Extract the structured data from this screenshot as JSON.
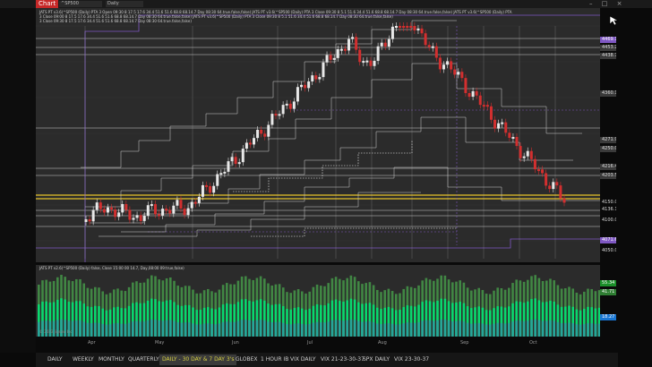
{
  "window": {
    "chart_tab": "Chart",
    "symbol": "^SP500",
    "timeframe": "Daily",
    "controls": "– □ ×"
  },
  "price_panel": {
    "header_lines": [
      "JATS PT v3.6(^SP500 (Daily) PTA 3 Open 09:30 8 17.5 17.6 34.4 51.6 51.6 68.8 68.14.7 Day 08:30 64.true.false,false) JATS PT v3.6(^SP500 (Daily) PTA 3 Close 09:30 8 5.1 51.6 34.4 51.6 68.8 68.14.7 Day 08:30 64.true.false,false) JATS PT v3.6(^SP500 (Daily) PTA",
      "3 Close 09:00 8 17.5 17.6 34.4 51.6 51.6 68.8 68.14.7 Day 08:30 64.true.false,false) JATS PT v3.6(^SP500 (Daily) PTA 3 Close 09:30 8 5.1 51.6 34.4 51.6 68.8 68.14.7 Day 08:30 64.true.false,false)",
      "3 Close 09:30 8 17.5 17.6 34.4 51.6 51.6 68.8 68.14.7 Day 08:30 64.true.false,false)"
    ],
    "axis_ticks": [
      "4600.00",
      "4500.00",
      "4400.00",
      "4300.00",
      "4200.00",
      "4100.00",
      "4050.00"
    ],
    "price_labels": [
      {
        "text": "4469.17",
        "bg": "#7e57c2",
        "fg": "#ffffff"
      },
      {
        "text": "4453.25",
        "bg": "#3a3a3a",
        "fg": "#dddddd"
      },
      {
        "text": "4438.75",
        "bg": "#3a3a3a",
        "fg": "#dddddd"
      },
      {
        "text": "4360.11",
        "bg": "#3a3a3a",
        "fg": "#dddddd"
      },
      {
        "text": "4271.90",
        "bg": "#3a3a3a",
        "fg": "#dddddd"
      },
      {
        "text": "4250.00",
        "bg": "#3a3a3a",
        "fg": "#dddddd"
      },
      {
        "text": "4216.45",
        "bg": "#3a3a3a",
        "fg": "#dddddd"
      },
      {
        "text": "4203.50",
        "bg": "#3a3a3a",
        "fg": "#dddddd"
      },
      {
        "text": "4150.00",
        "bg": "#0a0a0a",
        "fg": "#dddddd"
      },
      {
        "text": "4136.12",
        "bg": "#0a0a0a",
        "fg": "#dddddd"
      },
      {
        "text": "4100.00",
        "bg": "#0a0a0a",
        "fg": "#dddddd"
      },
      {
        "text": "4071.62",
        "bg": "#7e57c2",
        "fg": "#ffffff"
      },
      {
        "text": "4050.00",
        "bg": "#0a0a0a",
        "fg": "#dddddd"
      }
    ]
  },
  "volume_panel": {
    "header": "JATS PT v2.6(^SP500 (Daily) false, Close 15:00 00 14.7, Day,08:00 09:true,false)",
    "watermark": "© 2023 Jigsaw Inc",
    "labels": [
      {
        "text": "55.34",
        "bg": "#1b8f2a"
      },
      {
        "text": "41.71",
        "bg": "#2e7d32"
      },
      {
        "text": "18.27",
        "bg": "#1976d2"
      }
    ]
  },
  "date_axis": [
    "Apr",
    "May",
    "Jun",
    "Jul",
    "Aug",
    "Sep",
    "Oct"
  ],
  "tabs": [
    {
      "label": "DAILY",
      "active": false
    },
    {
      "label": "WEEKLY",
      "active": false
    },
    {
      "label": "MONTHLY",
      "active": false
    },
    {
      "label": "QUARTERLY",
      "active": false
    },
    {
      "label": "DAILY - 30 DAY & 7 DAY 3's",
      "active": true
    },
    {
      "label": "GLOBEX",
      "active": false
    },
    {
      "label": "1 HOUR IB",
      "active": false
    },
    {
      "label": "VIX DAILY",
      "active": false
    },
    {
      "label": "VIX 21-23-30-37",
      "active": false
    },
    {
      "label": "SPX DAILY",
      "active": false
    },
    {
      "label": "VIX 23-30-37",
      "active": false
    }
  ],
  "colors": {
    "candle_up": "#e8e8e8",
    "candle_down": "#d32f2f",
    "yellow_line": "#e6c229",
    "purple_line": "#7e57c2",
    "white_line": "#cfcfcf",
    "volume_green_light": "#4caf50",
    "volume_green_bright": "#00e676",
    "volume_teal": "#26a69a"
  }
}
